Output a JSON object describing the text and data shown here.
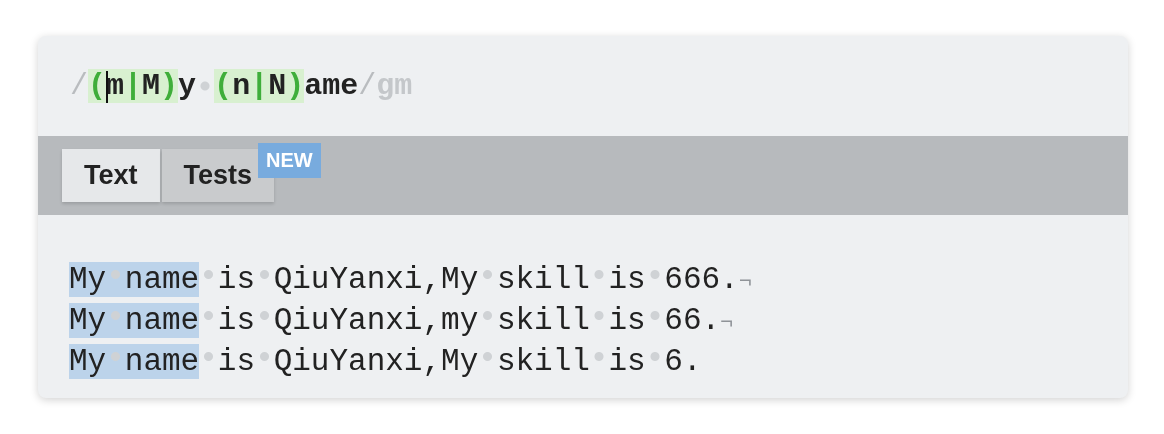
{
  "expression": {
    "tokens": [
      {
        "kind": "delimiter",
        "text": "/"
      },
      {
        "kind": "group",
        "parts": [
          {
            "kind": "paren",
            "text": "("
          },
          {
            "kind": "literal",
            "text": "m"
          },
          {
            "kind": "alt",
            "text": "|"
          },
          {
            "kind": "literal",
            "text": "M"
          },
          {
            "kind": "paren",
            "text": ")"
          }
        ]
      },
      {
        "kind": "literal",
        "text": "y"
      },
      {
        "kind": "space"
      },
      {
        "kind": "group",
        "parts": [
          {
            "kind": "paren",
            "text": "("
          },
          {
            "kind": "literal",
            "text": "n"
          },
          {
            "kind": "alt",
            "text": "|"
          },
          {
            "kind": "literal",
            "text": "N"
          },
          {
            "kind": "paren",
            "text": ")"
          }
        ]
      },
      {
        "kind": "literal",
        "text": "ame"
      },
      {
        "kind": "delimiter",
        "text": "/"
      },
      {
        "kind": "flags",
        "text": "gm"
      }
    ]
  },
  "tabs": [
    {
      "label": "Text",
      "selected": true
    },
    {
      "label": "Tests",
      "selected": false,
      "badge": "NEW"
    }
  ],
  "text_lines": [
    {
      "match": "My name",
      "rest": " is QiuYanxi,My skill is 666.",
      "eol": "¬"
    },
    {
      "match": "My name",
      "rest": " is QiuYanxi,my skill is 66.",
      "eol": "¬"
    },
    {
      "match": "My name",
      "rest": " is QiuYanxi,My skill is 6."
    }
  ]
}
